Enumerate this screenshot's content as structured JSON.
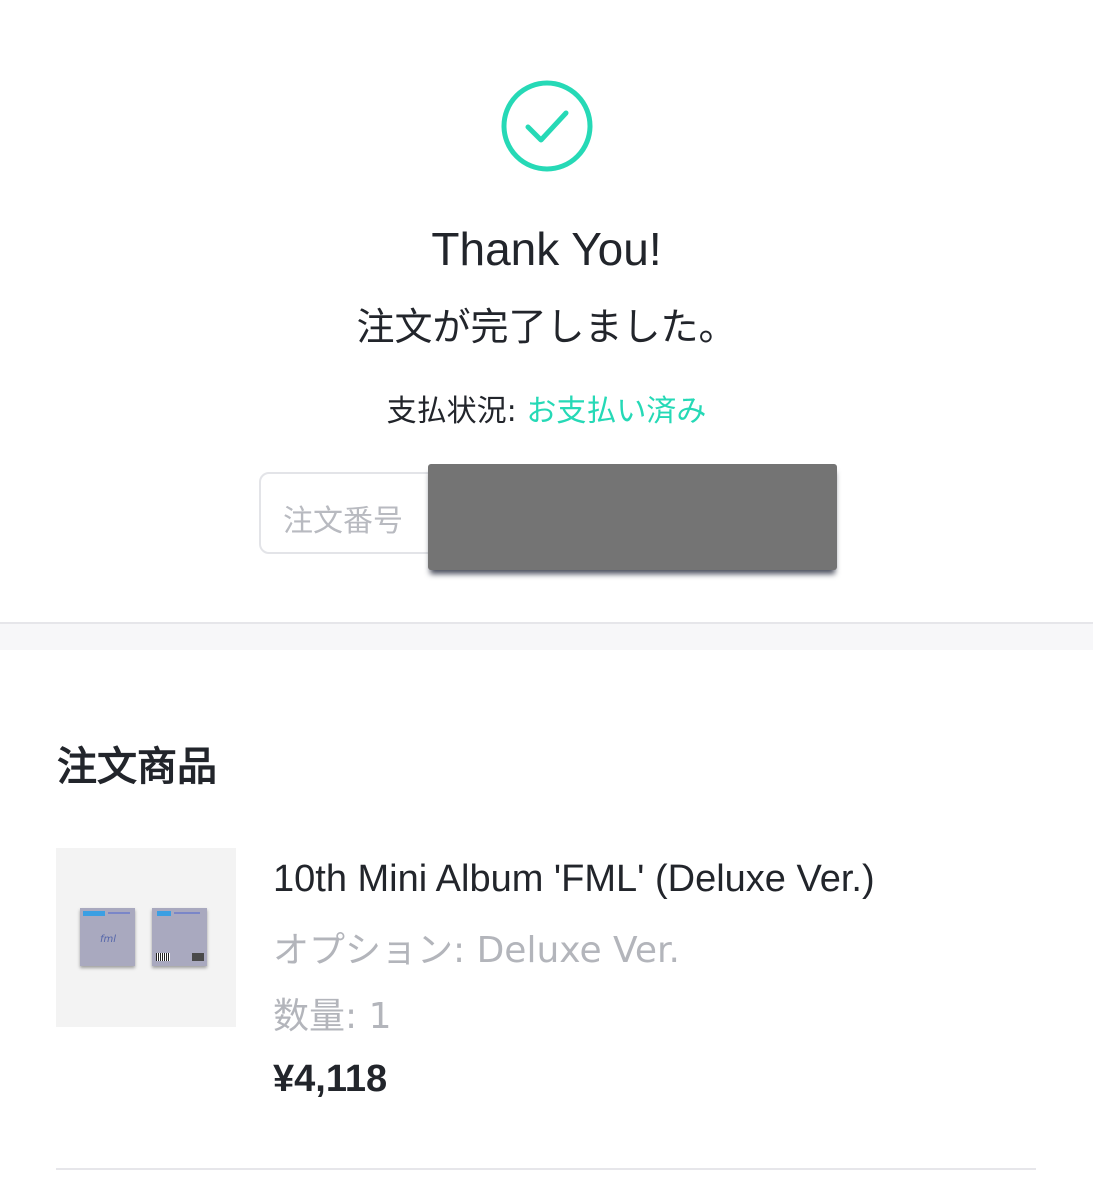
{
  "header": {
    "check_icon": "check-circle-icon",
    "accent_color": "#26d9b6",
    "thanks": "Thank You!",
    "completed": "注文が完了しました。",
    "payment_label": "支払状況: ",
    "payment_status": "お支払い済み"
  },
  "order": {
    "number_label": "注文番号"
  },
  "items_section": {
    "title": "注文商品",
    "items": [
      {
        "name": "10th Mini Album 'FML' (Deluxe Ver.)",
        "option": "オプション: Deluxe Ver.",
        "quantity": "数量: 1",
        "price": "¥4,118"
      }
    ]
  }
}
